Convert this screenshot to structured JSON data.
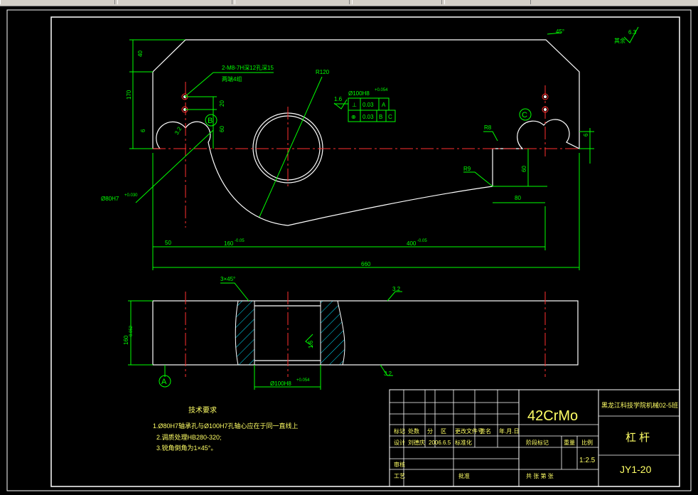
{
  "toolbar": {
    "segments": 6
  },
  "drawing": {
    "roughness_all": "其余",
    "roughness_all_value": "6.3",
    "chamfer_top": "45°",
    "hole_note": "2-M8-7H深12孔深15",
    "hole_note2": "两端4组",
    "radius_main": "R120",
    "dim_40": "40",
    "dim_170": "170",
    "dim_20": "20",
    "dim_60a": "60",
    "dim_6a": "6",
    "dim_6b": "6",
    "dim_32": "3.2",
    "datum_b": "B",
    "datum_c": "C",
    "datum_a": "A",
    "r8": "R8",
    "r9": "R9",
    "dim_60b": "60",
    "dim_80": "80",
    "bore_left": "Ø80H7",
    "bore_left_tol": "+0.030",
    "bore_center": "Ø100H8",
    "bore_center_tol": "+0.054",
    "rough_16": "1.6",
    "gdt_perp": "0.03",
    "gdt_perp_ref": "A",
    "gdt_pos": "0.03",
    "gdt_pos_ref1": "B",
    "gdt_pos_ref2": "C",
    "dim_50": "50",
    "dim_160": "160",
    "dim_160_tol": "-0.05",
    "dim_400": "400",
    "dim_400_tol": "-0.05",
    "dim_660": "660",
    "chamfer_bore": "3×45°",
    "rough_32_side": "3.2",
    "dim_thick": "160",
    "dim_thick_tol": "-0.052",
    "rough_16_side": "1.6",
    "rough_32_bottom": "3.2",
    "bore_bottom": "Ø100H8",
    "bore_bottom_tol": "+0.054"
  },
  "notes": {
    "title": "技术要求",
    "items": [
      "1.Ø80H7轴承孔与Ø100H7孔轴心应在于同一直线上",
      "2.调质处理HB280-320;",
      "3.锐角倒角为1×45°。"
    ]
  },
  "title_block": {
    "material": "42CrMo",
    "school": "黑龙江科技学院机械02-5班",
    "part_name": "杠  杆",
    "drawing_no": "JY1-20",
    "scale": "1:2.5",
    "rev_headers": [
      "标记",
      "处数",
      "分",
      "区",
      "更改文件号",
      "签名",
      "年.月.日"
    ],
    "design_label": "设计",
    "designer": "刘德庆",
    "date": "2006.6.5",
    "std_label": "标准化",
    "stage_label": "阶段标记",
    "weight_label": "重量",
    "scale_label": "比例",
    "review_label": "审核",
    "process_label": "工艺",
    "approve_label": "批准",
    "sheets": "共  张  第  张"
  }
}
